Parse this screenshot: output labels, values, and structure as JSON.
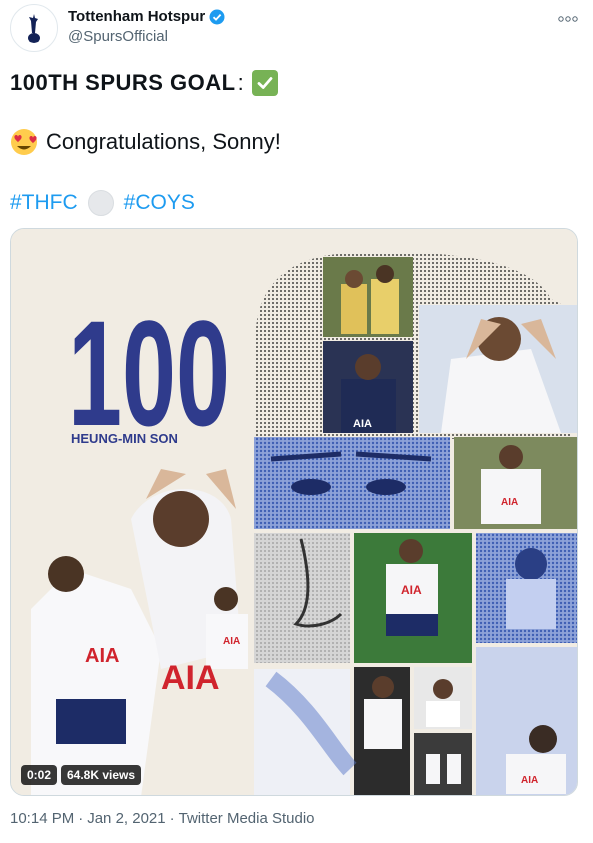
{
  "author": {
    "display_name": "Tottenham Hotspur",
    "handle": "@SpursOfficial",
    "verified": true,
    "avatar_icon": "spurs-cockerel-icon"
  },
  "tweet": {
    "line1_text": "100TH SPURS GOAL",
    "line1_suffix": ":",
    "line1_emoji": "white-check-mark-icon",
    "line2_emoji": "heart-eyes-face-icon",
    "line2_text": "Congratulations, Sonny!",
    "hashtags": [
      "#THFC",
      "#COYS"
    ],
    "hashtag_emoji": "spurs-ball-icon"
  },
  "media": {
    "graphic_number": "100",
    "graphic_name": "HEUNG-MIN SON",
    "jersey_sponsor": "AIA",
    "elapsed": "0:02",
    "views": "64.8K views"
  },
  "footer": {
    "time": "10:14 PM",
    "separator": "·",
    "date": "Jan 2, 2021",
    "source": "Twitter Media Studio"
  },
  "colors": {
    "hashtag": "#1d9bf0",
    "graphic_navy": "#2f3b8c",
    "graphic_blue": "#5a78c8",
    "background_cream": "#f1ece3"
  }
}
